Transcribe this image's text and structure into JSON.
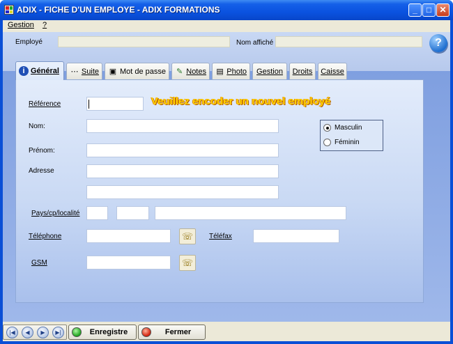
{
  "window": {
    "title": "ADIX - FICHE D'UN EMPLOYE - ADIX FORMATIONS"
  },
  "menu": {
    "items": [
      {
        "label": "Gestion"
      },
      {
        "label": "?"
      }
    ]
  },
  "header": {
    "employee_label": "Employé",
    "employee_value": "",
    "display_name_label": "Nom affiché",
    "display_name_value": ""
  },
  "tabs": [
    {
      "label": "Général",
      "icon": "info-icon",
      "active": true
    },
    {
      "label": "Suite",
      "icon": "dots-icon"
    },
    {
      "label": "Mot de passe",
      "icon": "password-icon"
    },
    {
      "label": "Notes",
      "icon": "notes-icon"
    },
    {
      "label": "Photo",
      "icon": "photo-icon"
    },
    {
      "label": "Gestion"
    },
    {
      "label": "Droits"
    },
    {
      "label": "Caisse"
    }
  ],
  "form": {
    "message": "Veuillez encoder un nouvel employé",
    "reference_label": "Référence",
    "reference_value": "",
    "nom_label": "Nom:",
    "nom_value": "",
    "prenom_label": "Prénom:",
    "prenom_value": "",
    "adresse_label": "Adresse",
    "adresse_line1": "",
    "adresse_line2": "",
    "pays_label": "Pays/cp/localité",
    "telephone_label": "Téléphone",
    "telefax_label": "Téléfax",
    "gsm_label": "GSM",
    "gender": {
      "options": [
        "Masculin",
        "Féminin"
      ],
      "selected": "Masculin"
    }
  },
  "footer": {
    "save_label": "Enregistre",
    "close_label": "Fermer",
    "nav_icons": [
      "first-record-icon",
      "prev-record-icon",
      "next-record-icon",
      "last-record-icon"
    ]
  },
  "colors": {
    "title_bar": "#0a52e0",
    "panel_bg": "#c9d9f4",
    "banner_text": "#ffd000",
    "save_led": "#1ea31e",
    "close_led": "#d21f0a"
  }
}
